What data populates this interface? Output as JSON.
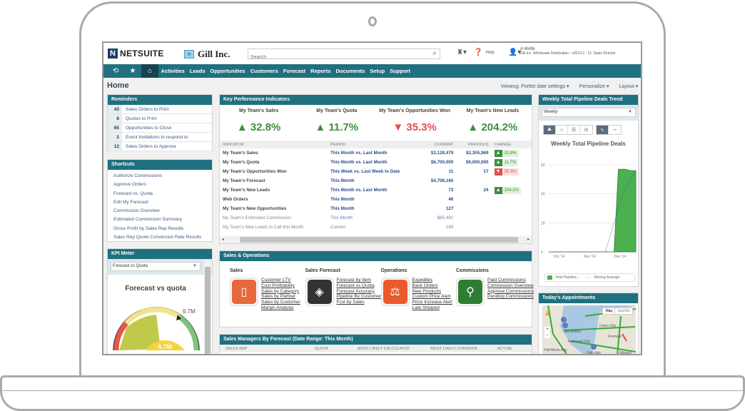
{
  "header": {
    "logo_mark": "N",
    "logo_text": "NETSUITE",
    "company_name": "Gill Inc.",
    "search_placeholder": "Search",
    "help_label": "Help",
    "user_name": "A Wolfe",
    "user_role": "Gill Inc. Wholesale Distribution - v2014.2 - 11: Sales Director"
  },
  "nav": {
    "items": [
      "Activities",
      "Leads",
      "Opportunities",
      "Customers",
      "Forecast",
      "Reports",
      "Documents",
      "Setup",
      "Support"
    ]
  },
  "page": {
    "title": "Home",
    "viewing": "Viewing: Portlet date settings ▾",
    "personalize": "Personalize ▾",
    "layout": "Layout ▾"
  },
  "reminders": {
    "title": "Reminders",
    "items": [
      {
        "count": "43",
        "label": "Sales Orders to Print"
      },
      {
        "count": "6",
        "label": "Quotes to Print"
      },
      {
        "count": "65",
        "label": "Opportunities to Close"
      },
      {
        "count": "2",
        "label": "Event Invitations to respond to"
      },
      {
        "count": "12",
        "label": "Sales Orders to Approve"
      }
    ]
  },
  "shortcuts": {
    "title": "Shortcuts",
    "items": [
      "Authorize Commissions",
      "Approve Orders",
      "Forecast vs. Quota",
      "Edit My Forecast",
      "Commission Overview",
      "Estimated Commission Summary",
      "Gross Profit by Sales Rep Results",
      "Sales Rep Quote Conversion Rate Results"
    ]
  },
  "kpi_meter": {
    "title": "KPI Meter",
    "selected": "Forecast vs Quota",
    "chart_title": "Forecast vs quota",
    "max_label": "6.7M",
    "value_label": "4.7M",
    "value": 4.7,
    "target": 6.7,
    "colors": {
      "red": "#e8554a",
      "yellow": "#f5d33a",
      "green": "#5cb85c",
      "olive": "#b6bf2c"
    }
  },
  "kpi": {
    "title": "Key Performance Indicators",
    "summary": [
      {
        "label": "My Team's Sales",
        "value": "32.8%",
        "dir": "up"
      },
      {
        "label": "My Team's Quota",
        "value": "11.7%",
        "dir": "up"
      },
      {
        "label": "My Team's Opportunities Won",
        "value": "35.3%",
        "dir": "down"
      },
      {
        "label": "My Team's New Leads",
        "value": "204.2%",
        "dir": "up"
      }
    ],
    "columns": [
      "INDICATOR",
      "PERIOD",
      "CURRENT",
      "PREVIOUS",
      "CHANGE"
    ],
    "rows": [
      {
        "indicator": "My Team's Sales",
        "period": "This Month vs. Last Month",
        "current": "$3,128,479",
        "previous": "$2,355,969",
        "change": "32.8%",
        "dir": "up"
      },
      {
        "indicator": "My Team's Quota",
        "period": "This Month vs. Last Month",
        "current": "$6,700,000",
        "previous": "$6,000,000",
        "change": "11.7%",
        "dir": "up"
      },
      {
        "indicator": "My Team's Opportunities Won",
        "period": "This Week vs. Last Week to Date",
        "current": "11",
        "previous": "17",
        "change": "35.3%",
        "dir": "down"
      },
      {
        "indicator": "My Team's Forecast",
        "period": "This Month",
        "current": "$4,708,160",
        "previous": "",
        "change": "",
        "dir": ""
      },
      {
        "indicator": "My Team's New Leads",
        "period": "This Month vs. Last Month",
        "current": "73",
        "previous": "24",
        "change": "204.2%",
        "dir": "up"
      },
      {
        "indicator": "Web Orders",
        "period": "This Month",
        "current": "46",
        "previous": "",
        "change": "",
        "dir": ""
      },
      {
        "indicator": "My Team's New Opportunities",
        "period": "This Month",
        "current": "127",
        "previous": "",
        "change": "",
        "dir": ""
      },
      {
        "indicator": "My Team's Estimated Commission",
        "period": "This Month",
        "current": "$65,491",
        "previous": "",
        "change": "",
        "dir": "",
        "light": true
      },
      {
        "indicator": "My Team's New Leads to Call this Month",
        "period": "Current",
        "current": "165",
        "previous": "",
        "change": "",
        "dir": "",
        "light": true
      }
    ],
    "colors": {
      "up": "#3e8e3e",
      "down": "#e05050"
    }
  },
  "sales_ops": {
    "title": "Sales & Operations",
    "columns": [
      {
        "title": "Sales",
        "icon": "document-icon",
        "color": "#e8683a",
        "links": [
          "Customer LTV",
          "Cust Profitability",
          "Sales by Category",
          "Sales by Partner",
          "Sales by Customer",
          "Margin Analysis"
        ]
      },
      {
        "title": "Sales Forecast",
        "icon": "forecast-icon",
        "color": "#333333",
        "links": [
          "Forecast by Item",
          "Forecast vs Quota",
          "Forecast Accuracy",
          "Pipeline By Customer",
          "Fcst by Sales"
        ]
      },
      {
        "title": "Operations",
        "icon": "scales-icon",
        "color": "#ea5a2a",
        "links": [
          "Expedites",
          "Back Orders",
          "New Products",
          "Custom Price Alert",
          "Price Increase Alert",
          "Late Shipped"
        ]
      },
      {
        "title": "Commissions",
        "icon": "magnifier-chart-icon",
        "color": "#2e7d32",
        "links": [
          "Paid Commissions",
          "Commission Overview",
          "Approve Commissions",
          "Pending Commissions"
        ]
      }
    ]
  },
  "sales_managers": {
    "title": "Sales Managers By Forecast (Date Range: This Month)",
    "columns": [
      "SALES REP",
      "QUOTA",
      "MOST LIKELY CALCULATED",
      "MOST LIKELY OVERRIDE",
      "ACTUAL"
    ]
  },
  "pipeline": {
    "title": "Weekly Total Pipeline Deals Trend",
    "selected": "Weekly",
    "chart_title": "Weekly Total Pipeline Deals",
    "legend": [
      "Total Pipeline...",
      "Moving Average"
    ]
  },
  "chart_data": {
    "type": "area",
    "title": "Weekly Total Pipeline Deals",
    "x": [
      "Oct '14",
      "Nov '14",
      "Dec '14"
    ],
    "xlabel": "",
    "ylabel": "",
    "ylim": [
      0,
      60
    ],
    "yticks": [
      0,
      20,
      40,
      60
    ],
    "grid": true,
    "legend_position": "bottom",
    "series": [
      {
        "name": "Total Pipeline",
        "type": "area",
        "color": "#4caf50",
        "points": [
          [
            0,
            0
          ],
          [
            0.1,
            0
          ],
          [
            0.2,
            0
          ],
          [
            0.3,
            0
          ],
          [
            0.4,
            0
          ],
          [
            0.5,
            0
          ],
          [
            0.6,
            0
          ],
          [
            0.7,
            0
          ],
          [
            0.75,
            0
          ],
          [
            0.8,
            57
          ],
          [
            0.88,
            57
          ],
          [
            0.94,
            56
          ],
          [
            1.0,
            56
          ]
        ]
      },
      {
        "name": "Moving Average",
        "type": "line",
        "style": "dotted",
        "color": "#3a6ab0",
        "points": [
          [
            0,
            0
          ],
          [
            0.6,
            0
          ],
          [
            0.65,
            0
          ],
          [
            0.75,
            20
          ],
          [
            0.85,
            40
          ],
          [
            1.0,
            56
          ]
        ]
      }
    ]
  },
  "appointments": {
    "title": "Today's Appointments",
    "map_btn": "Map",
    "sat_btn": "Satellite",
    "places": [
      "Union City",
      "Fremont",
      "San Mateo",
      "Redwood City",
      "Half Moon Bay",
      "Palo Alto",
      "Milpitas"
    ]
  }
}
